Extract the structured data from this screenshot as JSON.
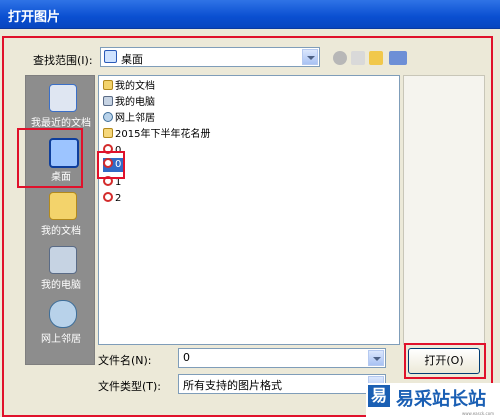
{
  "window": {
    "title": "打开图片"
  },
  "toolbar": {
    "lookin_label": "查找范围(I):",
    "lookin_value": "桌面"
  },
  "places": [
    {
      "label": "我最近的文档",
      "icon": "recent-documents-icon"
    },
    {
      "label": "桌面",
      "icon": "desktop-icon"
    },
    {
      "label": "我的文档",
      "icon": "my-documents-icon"
    },
    {
      "label": "我的电脑",
      "icon": "my-computer-icon"
    },
    {
      "label": "网上邻居",
      "icon": "network-places-icon"
    }
  ],
  "files": [
    {
      "name": "我的文档",
      "icon": "my-documents-icon"
    },
    {
      "name": "我的电脑",
      "icon": "my-computer-icon"
    },
    {
      "name": "网上邻居",
      "icon": "network-places-icon"
    },
    {
      "name": "2015年下半年花名册",
      "icon": "folder-icon"
    },
    {
      "name": "0",
      "icon": "image-file-icon"
    },
    {
      "name": "0",
      "icon": "image-file-icon"
    },
    {
      "name": "1",
      "icon": "image-file-icon"
    },
    {
      "name": "2",
      "icon": "image-file-icon"
    }
  ],
  "bottom": {
    "filename_label": "文件名(N):",
    "filename_value": "0",
    "filetype_label": "文件类型(T):",
    "filetype_value": "所有支持的图片格式",
    "open_label": "打开(O)"
  },
  "watermark": {
    "logo": "易",
    "text": "易采站长站",
    "url": "www.easck.com"
  },
  "colors": {
    "highlight": "#e0112b",
    "titlebar": "#0a4fd1"
  }
}
